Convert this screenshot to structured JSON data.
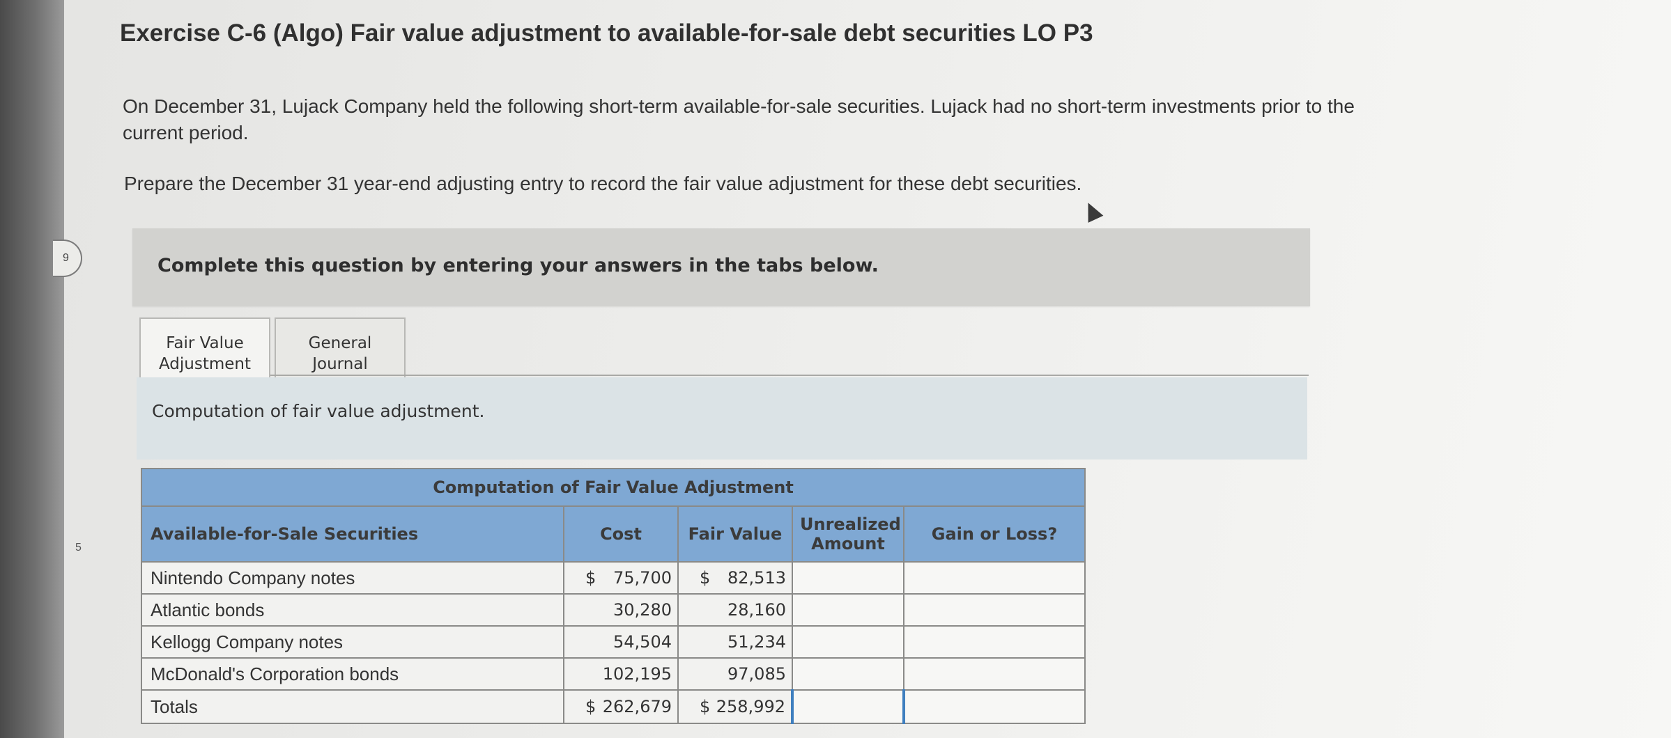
{
  "exercise": {
    "title": "Exercise C-6 (Algo) Fair value adjustment to available-for-sale debt securities LO P3",
    "intro": "On December 31, Lujack Company held the following short-term available-for-sale securities. Lujack had no short-term investments prior to the current period.",
    "instruction": "Prepare the December 31 year-end adjusting entry to record the fair value adjustment for these debt securities."
  },
  "question_marker": "9",
  "side_digit": "5",
  "banner": {
    "text": "Complete this question by entering your answers in the tabs below."
  },
  "tabs": [
    {
      "line1": "Fair Value",
      "line2": "Adjustment",
      "active": true
    },
    {
      "line1": "General",
      "line2": "Journal",
      "active": false
    }
  ],
  "panel": {
    "text": "Computation of fair value adjustment."
  },
  "table": {
    "caption": "Computation of Fair Value Adjustment",
    "headers": {
      "security": "Available-for-Sale Securities",
      "cost": "Cost",
      "fair_value": "Fair Value",
      "unrealized_line1": "Unrealized",
      "unrealized_line2": "Amount",
      "gain_loss": "Gain or Loss?"
    },
    "rows": [
      {
        "name": "Nintendo Company notes",
        "cost_prefix": "$",
        "cost": "75,700",
        "fv_prefix": "$",
        "fv": "82,513",
        "unrealized": "",
        "gain_loss": ""
      },
      {
        "name": "Atlantic bonds",
        "cost_prefix": "",
        "cost": "30,280",
        "fv_prefix": "",
        "fv": "28,160",
        "unrealized": "",
        "gain_loss": ""
      },
      {
        "name": "Kellogg Company notes",
        "cost_prefix": "",
        "cost": "54,504",
        "fv_prefix": "",
        "fv": "51,234",
        "unrealized": "",
        "gain_loss": ""
      },
      {
        "name": "McDonald's Corporation bonds",
        "cost_prefix": "",
        "cost": "102,195",
        "fv_prefix": "",
        "fv": "97,085",
        "unrealized": "",
        "gain_loss": ""
      }
    ],
    "totals": {
      "name": "Totals",
      "cost_prefix": "$",
      "cost": "262,679",
      "fv_prefix": "$",
      "fv": "258,992",
      "unrealized": "",
      "gain_loss": ""
    }
  }
}
